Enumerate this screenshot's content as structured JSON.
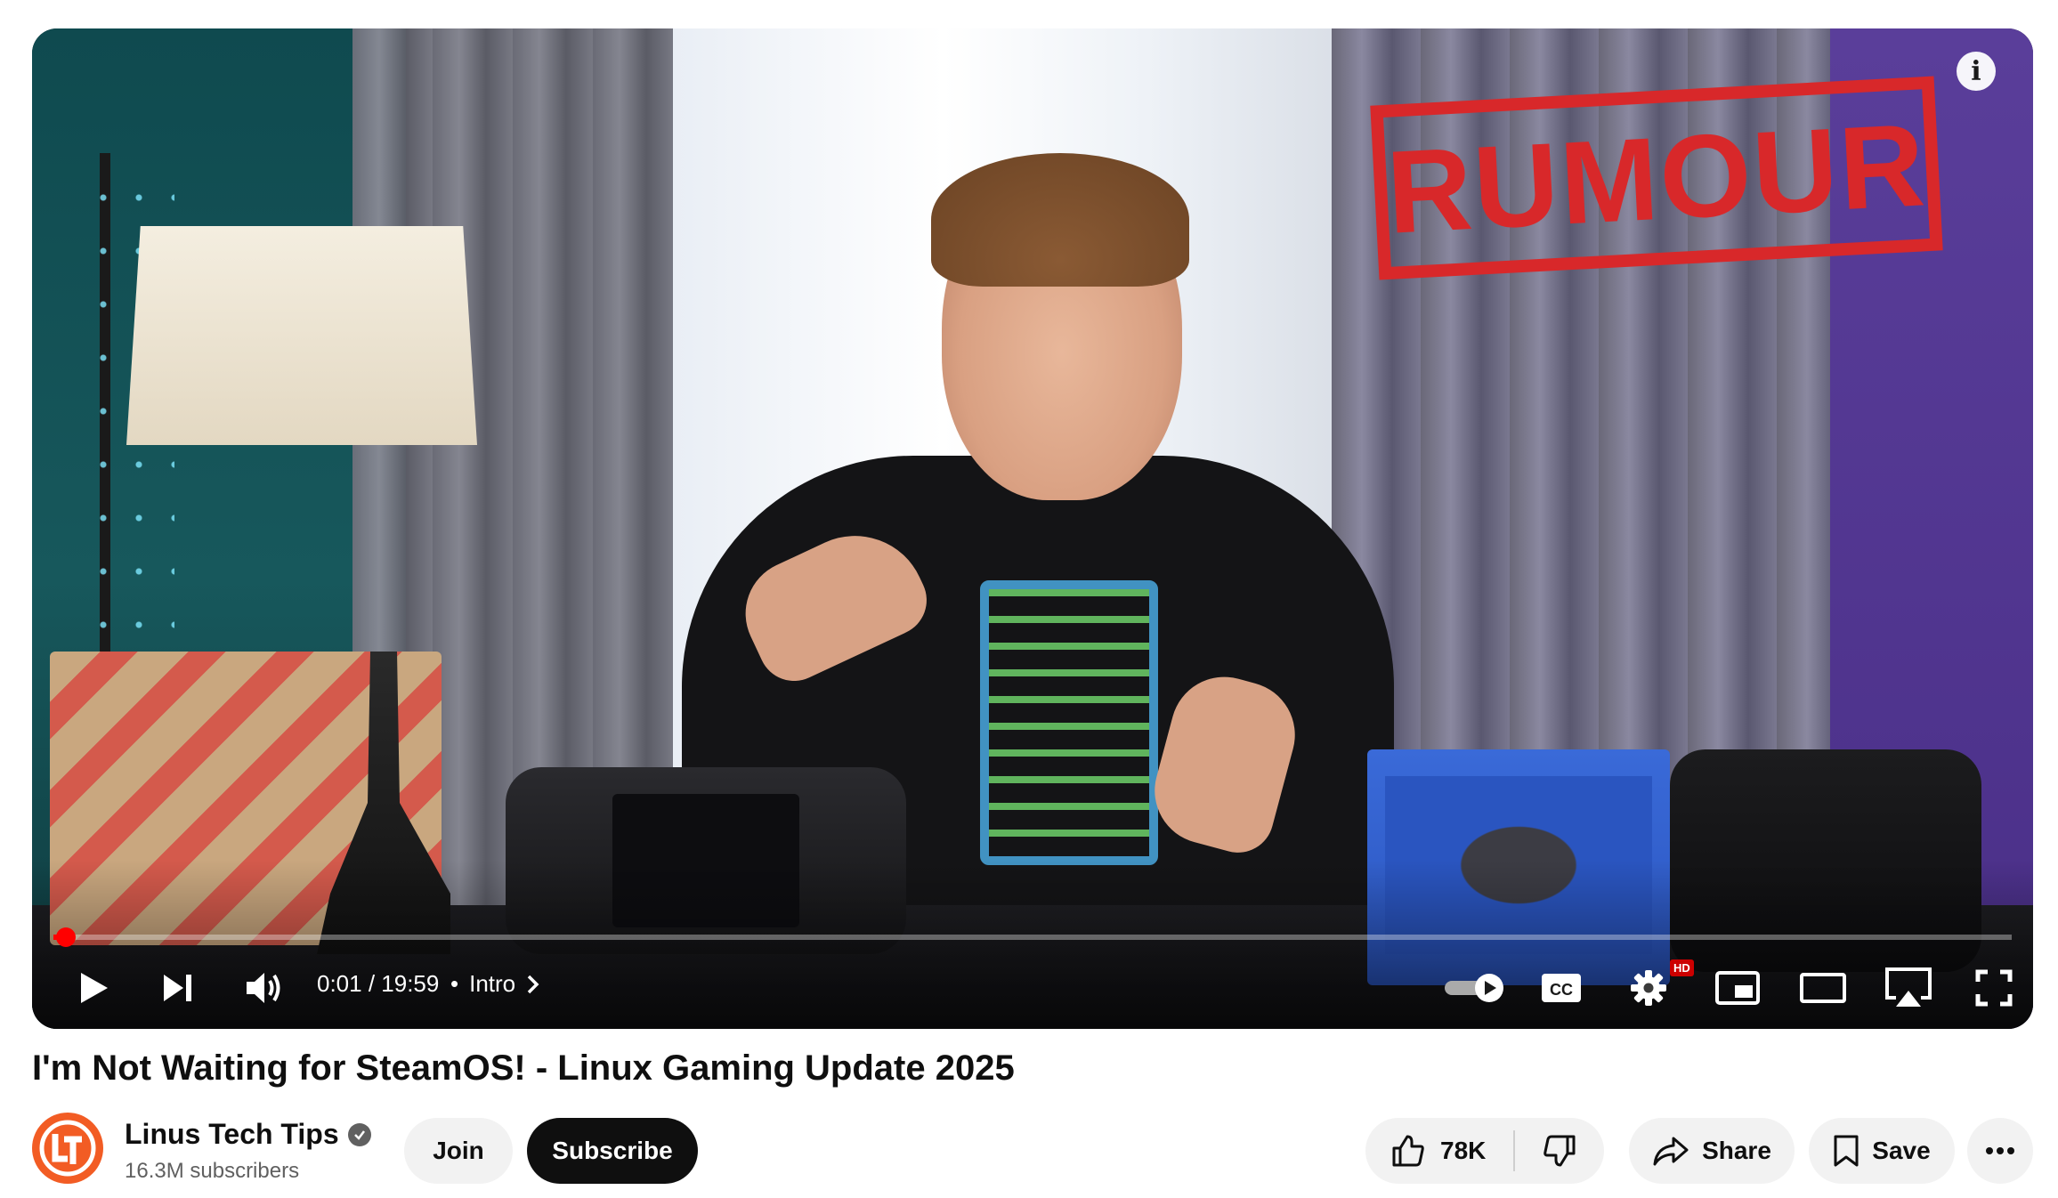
{
  "player": {
    "overlay_stamp": "RUMOUR",
    "info_glyph": "i",
    "progress": {
      "played_fraction": 0.001
    },
    "time_current": "0:01",
    "time_separator": " / ",
    "time_total": "19:59",
    "chapter_bullet": "•",
    "chapter_label": "Intro",
    "hd_badge": "HD",
    "cc_label": "CC",
    "icons": [
      "play-icon",
      "next-icon",
      "volume-icon",
      "chevron-right-icon",
      "autoplay-toggle-icon",
      "cc-icon",
      "settings-icon",
      "miniplayer-icon",
      "theater-icon",
      "airplay-icon",
      "fullscreen-icon",
      "info-icon"
    ]
  },
  "video": {
    "title": "I'm Not Waiting for SteamOS! - Linux Gaming Update 2025"
  },
  "channel": {
    "name": "Linus Tech Tips",
    "subscribers": "16.3M subscribers",
    "join_label": "Join",
    "subscribe_label": "Subscribe"
  },
  "actions": {
    "like_count": "78K",
    "share_label": "Share",
    "save_label": "Save"
  },
  "colors": {
    "accent_red": "#ff0000",
    "stamp_red": "#d8282a",
    "pill_bg": "#f2f2f2",
    "dark_button": "#0f0f0f",
    "avatar_orange": "#f25c24"
  }
}
